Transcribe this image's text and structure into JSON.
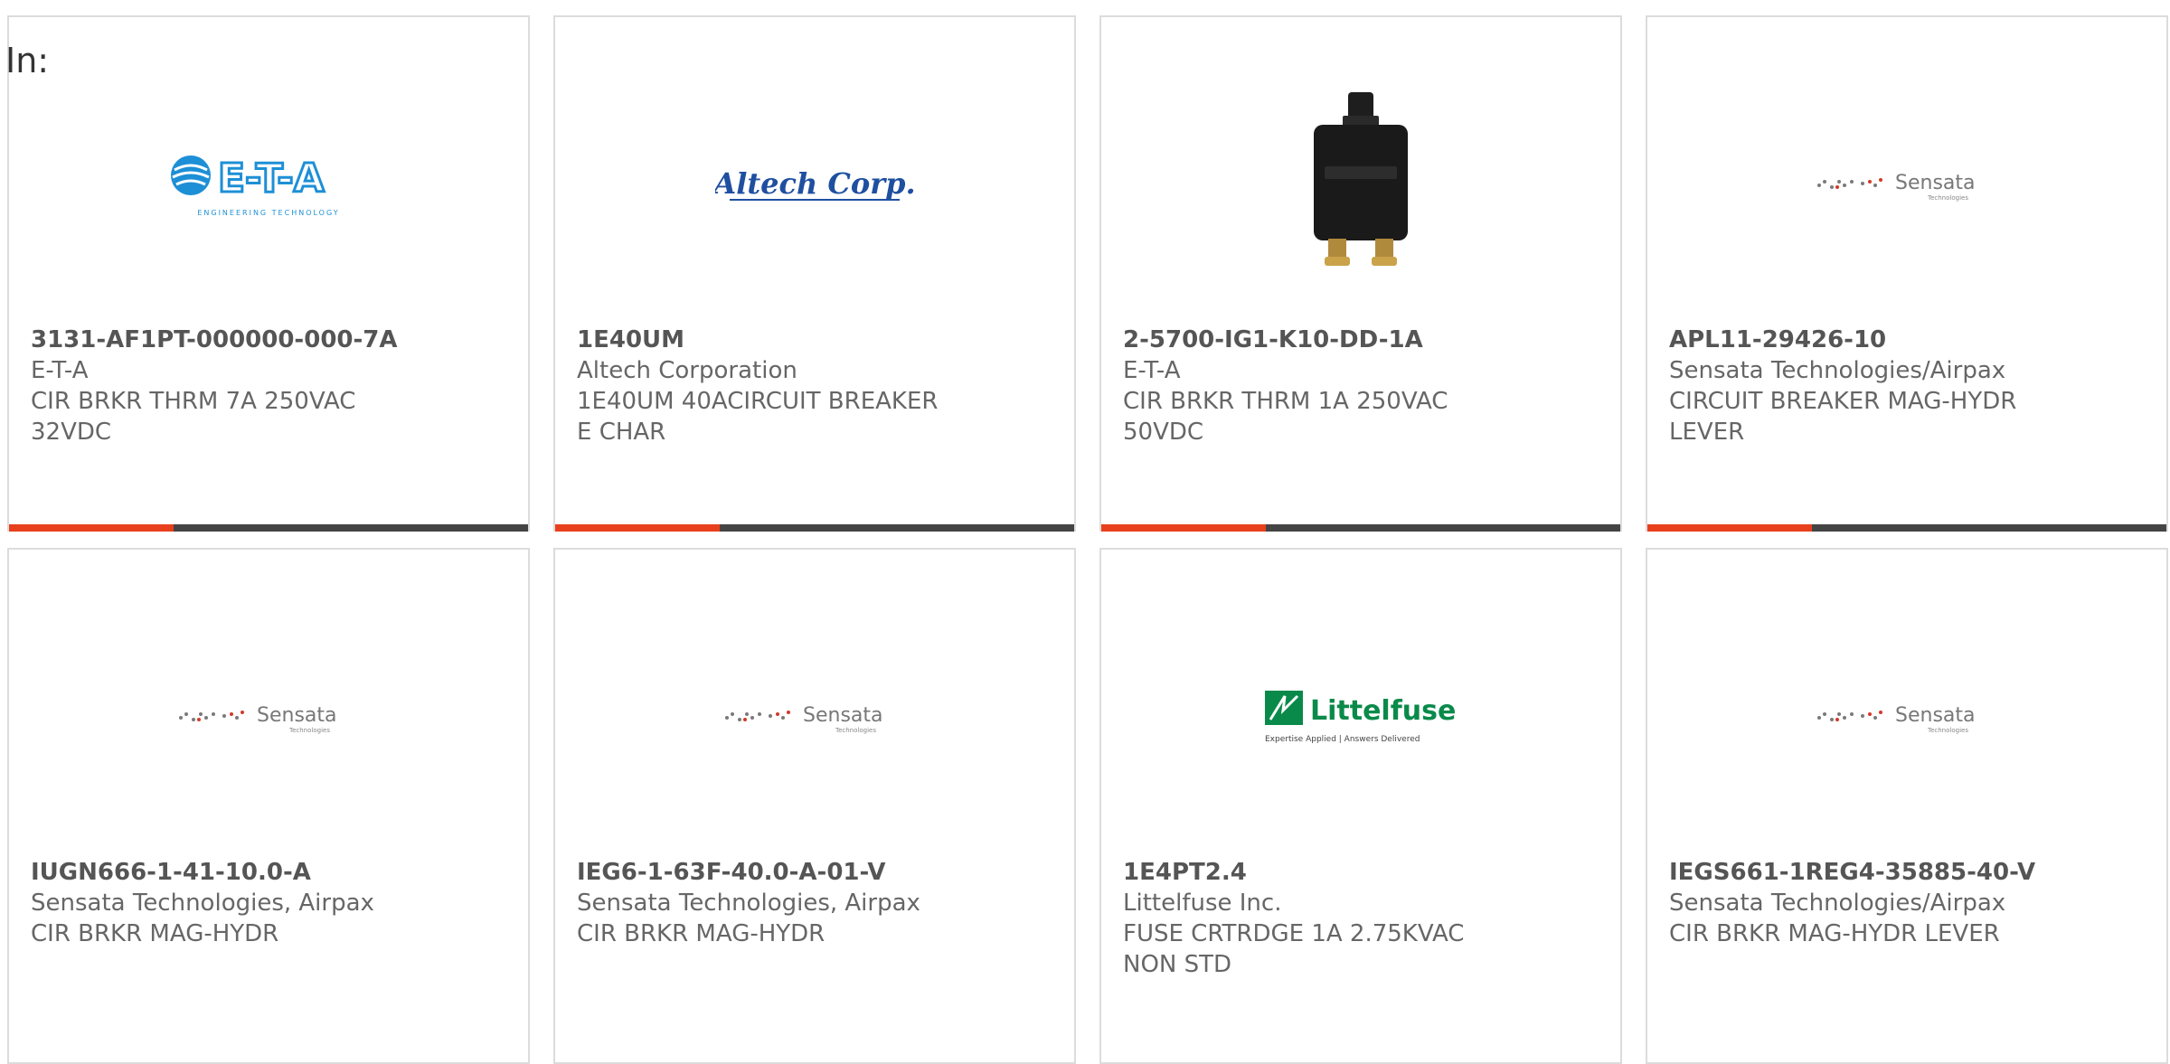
{
  "filter_label": "In:",
  "colors": {
    "accent": "#e8401c",
    "bar": "#444444",
    "border": "#dcdcdc"
  },
  "products": [
    {
      "part_number": "3131-AF1PT-000000-000-7A",
      "manufacturer": "E-T-A",
      "description": "CIR BRKR THRM 7A 250VAC 32VDC",
      "logo": "eta-logo",
      "logo_text": "E-T-A",
      "logo_sub": "ENGINEERING TECHNOLOGY"
    },
    {
      "part_number": "1E40UM",
      "manufacturer": "Altech Corporation",
      "description": "1E40UM 40ACIRCUIT BREAKER E CHAR",
      "logo": "altech-logo",
      "logo_text": "Altech Corp."
    },
    {
      "part_number": "2-5700-IG1-K10-DD-1A",
      "manufacturer": "E-T-A",
      "description": "CIR BRKR THRM 1A 250VAC 50VDC",
      "logo": "breaker-product-image"
    },
    {
      "part_number": "APL11-29426-10",
      "manufacturer": "Sensata Technologies/Airpax",
      "description": "CIRCUIT BREAKER MAG-HYDR LEVER",
      "logo": "sensata-logo",
      "logo_text": "Sensata",
      "logo_sub": "Technologies"
    },
    {
      "part_number": "IUGN666-1-41-10.0-A",
      "manufacturer": "Sensata Technologies, Airpax",
      "description": "CIR BRKR MAG-HYDR",
      "logo": "sensata-logo",
      "logo_text": "Sensata",
      "logo_sub": "Technologies"
    },
    {
      "part_number": "IEG6-1-63F-40.0-A-01-V",
      "manufacturer": "Sensata Technologies, Airpax",
      "description": "CIR BRKR MAG-HYDR",
      "logo": "sensata-logo",
      "logo_text": "Sensata",
      "logo_sub": "Technologies"
    },
    {
      "part_number": "1E4PT2.4",
      "manufacturer": "Littelfuse Inc.",
      "description": "FUSE CRTRDGE 1A 2.75KVAC NON STD",
      "logo": "littelfuse-logo",
      "logo_text": "Littelfuse",
      "logo_sub": "Expertise Applied | Answers Delivered"
    },
    {
      "part_number": "IEGS661-1REG4-35885-40-V",
      "manufacturer": "Sensata Technologies/Airpax",
      "description": "CIR BRKR MAG-HYDR LEVER",
      "logo": "sensata-logo",
      "logo_text": "Sensata",
      "logo_sub": "Technologies"
    }
  ]
}
